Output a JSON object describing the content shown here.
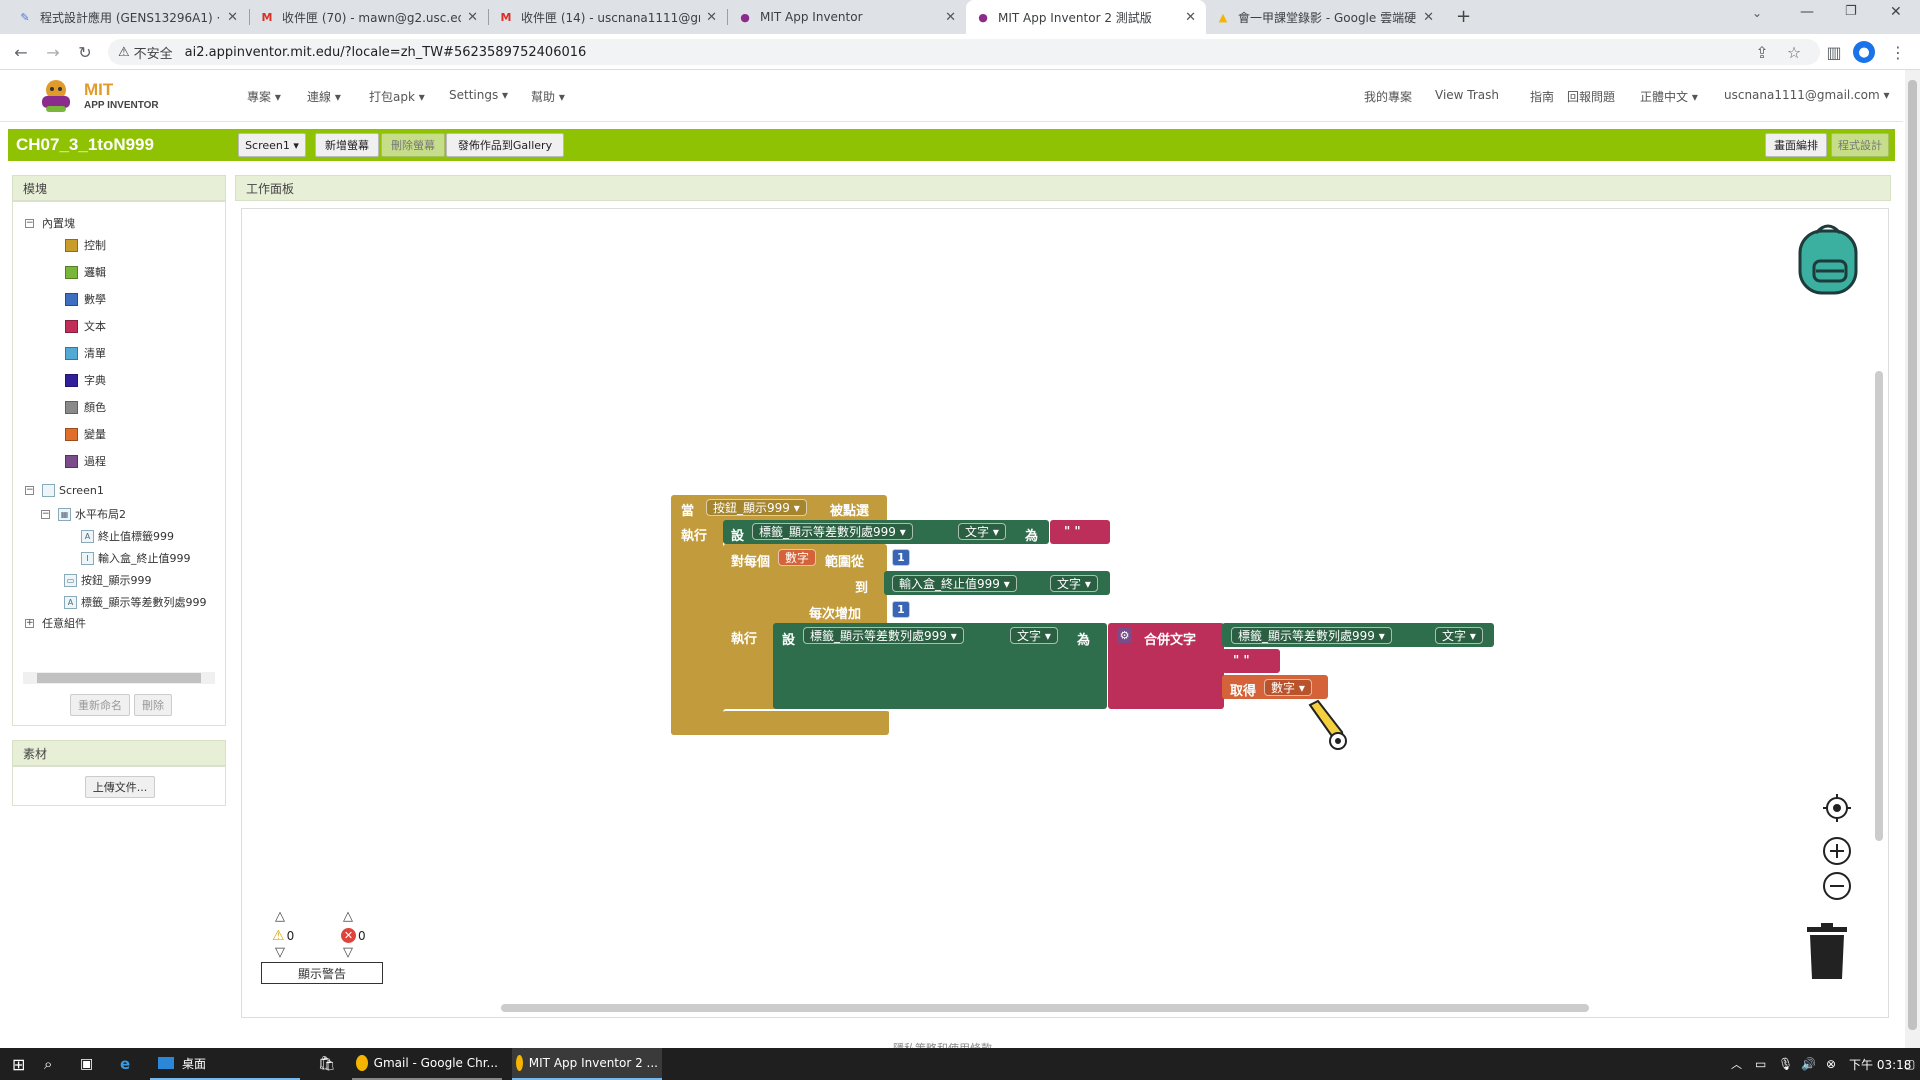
{
  "browser": {
    "tabs": [
      {
        "title": "程式設計應用 (GENS13296A1) ·",
        "icon": "classroom-icon"
      },
      {
        "title": "收件匣 (70) - mawn@g2.usc.ed",
        "icon": "gmail-icon"
      },
      {
        "title": "收件匣 (14) - uscnana1111@gr",
        "icon": "gmail-icon"
      },
      {
        "title": "MIT App Inventor",
        "icon": "appinventor-icon"
      },
      {
        "title": "MIT App Inventor 2 測試版",
        "icon": "appinventor-icon",
        "active": true
      },
      {
        "title": "會一甲課堂錄影 - Google 雲端硬",
        "icon": "drive-icon"
      }
    ],
    "new_tab": "+",
    "security_label": "不安全",
    "url": "ai2.appinventor.mit.edu/?locale=zh_TW#5623589752406016"
  },
  "app": {
    "logo_line1": "MIT",
    "logo_line2": "APP INVENTOR",
    "menu_left": [
      "專案 ▾",
      "連線 ▾",
      "打包apk ▾",
      "Settings ▾",
      "幫助 ▾"
    ],
    "menu_right": [
      "我的專案",
      "View Trash",
      "指南",
      "回報問題",
      "正體中文 ▾",
      "uscnana1111@gmail.com ▾"
    ],
    "project_name": "CH07_3_1toN999",
    "screen_select": "Screen1 ▾",
    "add_screen": "新增螢幕",
    "remove_screen": "刪除螢幕",
    "publish_gallery": "發佈作品到Gallery",
    "designer_btn": "畫面編排",
    "blocks_btn": "程式設計"
  },
  "blocks_panel": {
    "title": "模塊",
    "builtin": "內置塊",
    "categories": [
      {
        "label": "控制",
        "color": "#c89d2c"
      },
      {
        "label": "邏輯",
        "color": "#79b63a"
      },
      {
        "label": "數學",
        "color": "#3d6ec0"
      },
      {
        "label": "文本",
        "color": "#c12e59"
      },
      {
        "label": "清單",
        "color": "#52a9d4"
      },
      {
        "label": "字典",
        "color": "#2f1f9a"
      },
      {
        "label": "顏色",
        "color": "#8a8a8a"
      },
      {
        "label": "變量",
        "color": "#e06f2c"
      },
      {
        "label": "過程",
        "color": "#7a4c8a"
      }
    ],
    "screen": "Screen1",
    "components": [
      {
        "label": "水平布局2",
        "level": 1
      },
      {
        "label": "終止值標籤999",
        "level": 2
      },
      {
        "label": "輸入盒_終止值999",
        "level": 2
      },
      {
        "label": "按鈕_顯示999",
        "level": 1
      },
      {
        "label": "標籤_顯示等差數列處999",
        "level": 1
      }
    ],
    "any_component": "任意組件",
    "rename_btn": "重新命名",
    "delete_btn": "刪除"
  },
  "media_panel": {
    "title": "素材",
    "upload_btn": "上傳文件..."
  },
  "workspace": {
    "title": "工作面板",
    "warnings_count": "0",
    "errors_count": "0",
    "show_warnings_btn": "顯示警告",
    "footer_text": "隱私策略和使用條款",
    "event": {
      "when": "當",
      "component": "按鈕_顯示999 ▾",
      "event": "被點選",
      "do": "執行"
    },
    "set1": {
      "set": "設",
      "component": "標籤_顯示等差數列處999 ▾",
      "prop": "文字 ▾",
      "to": "為",
      "string": "\" \""
    },
    "loop": {
      "for_each": "對每個",
      "var": "數字",
      "from": "範圍從",
      "from_val": "1",
      "to": "到",
      "to_comp": "輸入盒_終止值999 ▾",
      "to_prop": "文字 ▾",
      "by": "每次增加",
      "by_val": "1",
      "do": "執行"
    },
    "set2": {
      "set": "設",
      "component": "標籤_顯示等差數列處999 ▾",
      "prop": "文字 ▾",
      "to": "為"
    },
    "join": {
      "label": "合併文字",
      "item_comp": "標籤_顯示等差數列處999 ▾",
      "item_prop": "文字 ▾",
      "string": "\" \"",
      "get": "取得",
      "get_var": "數字 ▾"
    }
  },
  "taskbar": {
    "desktop_label": "桌面",
    "apps": [
      "Gmail - Google Chr...",
      "MIT App Inventor 2 ..."
    ],
    "time": "下午 03:18"
  }
}
